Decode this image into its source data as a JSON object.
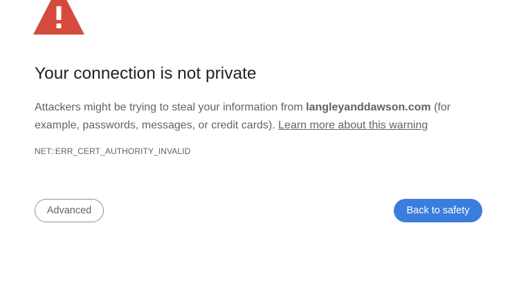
{
  "icon": {
    "name": "warning-icon",
    "color": "#d44b3d"
  },
  "title": "Your connection is not private",
  "message": {
    "prefix": "Attackers might be trying to steal your information from ",
    "domain": "langleyanddawson.com",
    "suffix": " (for example, passwords, messages, or credit cards). ",
    "learn_more": "Learn more about this warning"
  },
  "error_code": "NET::ERR_CERT_AUTHORITY_INVALID",
  "buttons": {
    "advanced": "Advanced",
    "back_to_safety": "Back to safety"
  },
  "colors": {
    "primary_button": "#3b7ddd",
    "title_text": "#202124",
    "body_text": "#5f6368"
  }
}
